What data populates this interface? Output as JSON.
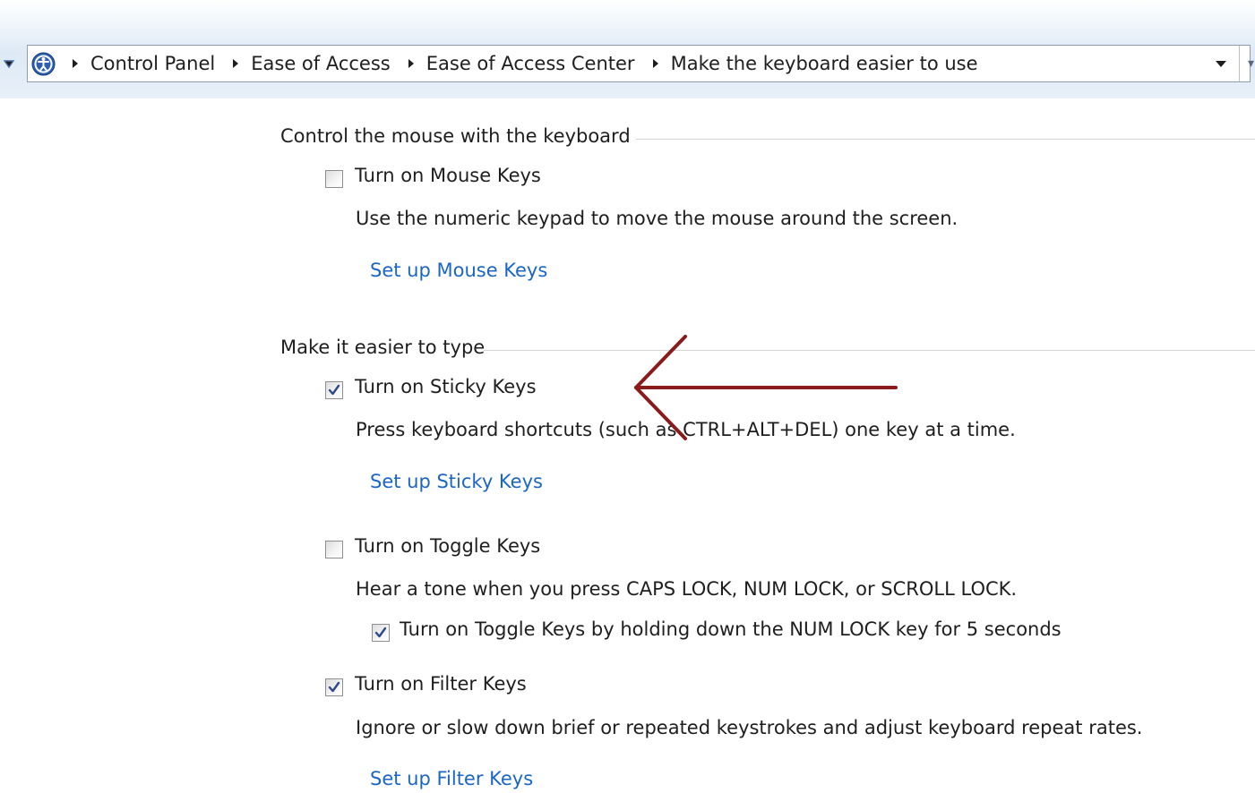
{
  "address_bar": {
    "breadcrumbs": [
      "Control Panel",
      "Ease of Access",
      "Ease of Access Center",
      "Make the keyboard easier to use"
    ],
    "icon": "control-panel-icon"
  },
  "sections": {
    "mouse": {
      "title": "Control the mouse with the keyboard",
      "mouse_keys": {
        "label": "Turn on Mouse Keys",
        "checked": false,
        "description": "Use the numeric keypad to move the mouse around the screen.",
        "link": "Set up Mouse Keys"
      }
    },
    "typing": {
      "title": "Make it easier to type",
      "sticky_keys": {
        "label": "Turn on Sticky Keys",
        "checked": true,
        "description": "Press keyboard shortcuts (such as CTRL+ALT+DEL) one key at a time.",
        "link": "Set up Sticky Keys"
      },
      "toggle_keys": {
        "label": "Turn on Toggle Keys",
        "checked": false,
        "description": "Hear a tone when you press CAPS LOCK, NUM LOCK, or SCROLL LOCK.",
        "sub_option": {
          "label": "Turn on Toggle Keys by holding down the NUM LOCK key for 5 seconds",
          "checked": true
        }
      },
      "filter_keys": {
        "label": "Turn on Filter Keys",
        "checked": true,
        "description": "Ignore or slow down brief or repeated keystrokes and adjust keyboard repeat rates.",
        "link": "Set up Filter Keys"
      }
    }
  },
  "colors": {
    "link": "#1a66c7",
    "annotation_arrow": "#8b1a1a",
    "text": "#1e1e1e"
  }
}
